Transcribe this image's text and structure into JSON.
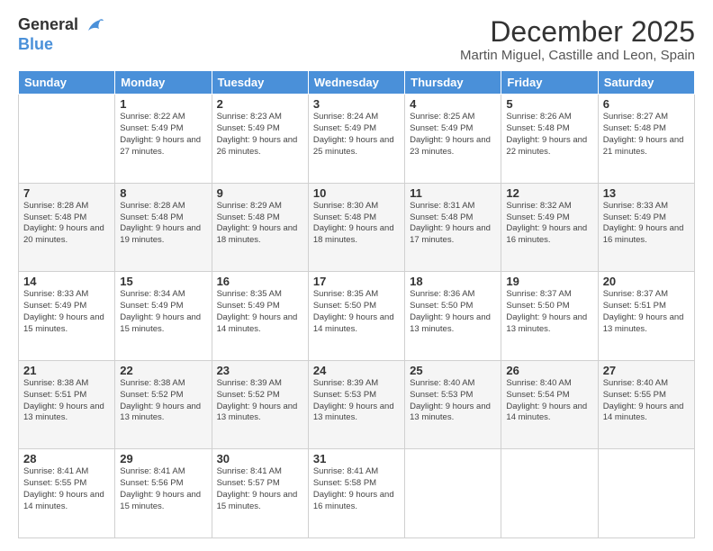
{
  "logo": {
    "general": "General",
    "blue": "Blue"
  },
  "header": {
    "month": "December 2025",
    "location": "Martin Miguel, Castille and Leon, Spain"
  },
  "weekdays": [
    "Sunday",
    "Monday",
    "Tuesday",
    "Wednesday",
    "Thursday",
    "Friday",
    "Saturday"
  ],
  "weeks": [
    [
      {
        "day": "",
        "sunrise": "",
        "sunset": "",
        "daylight": ""
      },
      {
        "day": "1",
        "sunrise": "Sunrise: 8:22 AM",
        "sunset": "Sunset: 5:49 PM",
        "daylight": "Daylight: 9 hours and 27 minutes."
      },
      {
        "day": "2",
        "sunrise": "Sunrise: 8:23 AM",
        "sunset": "Sunset: 5:49 PM",
        "daylight": "Daylight: 9 hours and 26 minutes."
      },
      {
        "day": "3",
        "sunrise": "Sunrise: 8:24 AM",
        "sunset": "Sunset: 5:49 PM",
        "daylight": "Daylight: 9 hours and 25 minutes."
      },
      {
        "day": "4",
        "sunrise": "Sunrise: 8:25 AM",
        "sunset": "Sunset: 5:49 PM",
        "daylight": "Daylight: 9 hours and 23 minutes."
      },
      {
        "day": "5",
        "sunrise": "Sunrise: 8:26 AM",
        "sunset": "Sunset: 5:48 PM",
        "daylight": "Daylight: 9 hours and 22 minutes."
      },
      {
        "day": "6",
        "sunrise": "Sunrise: 8:27 AM",
        "sunset": "Sunset: 5:48 PM",
        "daylight": "Daylight: 9 hours and 21 minutes."
      }
    ],
    [
      {
        "day": "7",
        "sunrise": "Sunrise: 8:28 AM",
        "sunset": "Sunset: 5:48 PM",
        "daylight": "Daylight: 9 hours and 20 minutes."
      },
      {
        "day": "8",
        "sunrise": "Sunrise: 8:28 AM",
        "sunset": "Sunset: 5:48 PM",
        "daylight": "Daylight: 9 hours and 19 minutes."
      },
      {
        "day": "9",
        "sunrise": "Sunrise: 8:29 AM",
        "sunset": "Sunset: 5:48 PM",
        "daylight": "Daylight: 9 hours and 18 minutes."
      },
      {
        "day": "10",
        "sunrise": "Sunrise: 8:30 AM",
        "sunset": "Sunset: 5:48 PM",
        "daylight": "Daylight: 9 hours and 18 minutes."
      },
      {
        "day": "11",
        "sunrise": "Sunrise: 8:31 AM",
        "sunset": "Sunset: 5:48 PM",
        "daylight": "Daylight: 9 hours and 17 minutes."
      },
      {
        "day": "12",
        "sunrise": "Sunrise: 8:32 AM",
        "sunset": "Sunset: 5:49 PM",
        "daylight": "Daylight: 9 hours and 16 minutes."
      },
      {
        "day": "13",
        "sunrise": "Sunrise: 8:33 AM",
        "sunset": "Sunset: 5:49 PM",
        "daylight": "Daylight: 9 hours and 16 minutes."
      }
    ],
    [
      {
        "day": "14",
        "sunrise": "Sunrise: 8:33 AM",
        "sunset": "Sunset: 5:49 PM",
        "daylight": "Daylight: 9 hours and 15 minutes."
      },
      {
        "day": "15",
        "sunrise": "Sunrise: 8:34 AM",
        "sunset": "Sunset: 5:49 PM",
        "daylight": "Daylight: 9 hours and 15 minutes."
      },
      {
        "day": "16",
        "sunrise": "Sunrise: 8:35 AM",
        "sunset": "Sunset: 5:49 PM",
        "daylight": "Daylight: 9 hours and 14 minutes."
      },
      {
        "day": "17",
        "sunrise": "Sunrise: 8:35 AM",
        "sunset": "Sunset: 5:50 PM",
        "daylight": "Daylight: 9 hours and 14 minutes."
      },
      {
        "day": "18",
        "sunrise": "Sunrise: 8:36 AM",
        "sunset": "Sunset: 5:50 PM",
        "daylight": "Daylight: 9 hours and 13 minutes."
      },
      {
        "day": "19",
        "sunrise": "Sunrise: 8:37 AM",
        "sunset": "Sunset: 5:50 PM",
        "daylight": "Daylight: 9 hours and 13 minutes."
      },
      {
        "day": "20",
        "sunrise": "Sunrise: 8:37 AM",
        "sunset": "Sunset: 5:51 PM",
        "daylight": "Daylight: 9 hours and 13 minutes."
      }
    ],
    [
      {
        "day": "21",
        "sunrise": "Sunrise: 8:38 AM",
        "sunset": "Sunset: 5:51 PM",
        "daylight": "Daylight: 9 hours and 13 minutes."
      },
      {
        "day": "22",
        "sunrise": "Sunrise: 8:38 AM",
        "sunset": "Sunset: 5:52 PM",
        "daylight": "Daylight: 9 hours and 13 minutes."
      },
      {
        "day": "23",
        "sunrise": "Sunrise: 8:39 AM",
        "sunset": "Sunset: 5:52 PM",
        "daylight": "Daylight: 9 hours and 13 minutes."
      },
      {
        "day": "24",
        "sunrise": "Sunrise: 8:39 AM",
        "sunset": "Sunset: 5:53 PM",
        "daylight": "Daylight: 9 hours and 13 minutes."
      },
      {
        "day": "25",
        "sunrise": "Sunrise: 8:40 AM",
        "sunset": "Sunset: 5:53 PM",
        "daylight": "Daylight: 9 hours and 13 minutes."
      },
      {
        "day": "26",
        "sunrise": "Sunrise: 8:40 AM",
        "sunset": "Sunset: 5:54 PM",
        "daylight": "Daylight: 9 hours and 14 minutes."
      },
      {
        "day": "27",
        "sunrise": "Sunrise: 8:40 AM",
        "sunset": "Sunset: 5:55 PM",
        "daylight": "Daylight: 9 hours and 14 minutes."
      }
    ],
    [
      {
        "day": "28",
        "sunrise": "Sunrise: 8:41 AM",
        "sunset": "Sunset: 5:55 PM",
        "daylight": "Daylight: 9 hours and 14 minutes."
      },
      {
        "day": "29",
        "sunrise": "Sunrise: 8:41 AM",
        "sunset": "Sunset: 5:56 PM",
        "daylight": "Daylight: 9 hours and 15 minutes."
      },
      {
        "day": "30",
        "sunrise": "Sunrise: 8:41 AM",
        "sunset": "Sunset: 5:57 PM",
        "daylight": "Daylight: 9 hours and 15 minutes."
      },
      {
        "day": "31",
        "sunrise": "Sunrise: 8:41 AM",
        "sunset": "Sunset: 5:58 PM",
        "daylight": "Daylight: 9 hours and 16 minutes."
      },
      {
        "day": "",
        "sunrise": "",
        "sunset": "",
        "daylight": ""
      },
      {
        "day": "",
        "sunrise": "",
        "sunset": "",
        "daylight": ""
      },
      {
        "day": "",
        "sunrise": "",
        "sunset": "",
        "daylight": ""
      }
    ]
  ]
}
